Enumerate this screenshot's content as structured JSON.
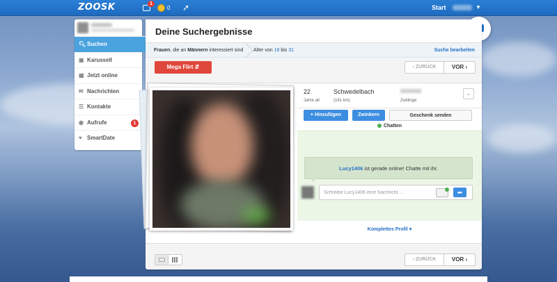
{
  "topbar": {
    "logo": "ZOOSK",
    "notifications_count": "1",
    "coins": "0",
    "start_label": "Start"
  },
  "chat_button": {
    "icon": "chat-bubble-icon"
  },
  "sidebar": {
    "items": [
      {
        "label": "Suchen",
        "icon": "search-icon",
        "active": true
      },
      {
        "label": "Karussell",
        "icon": "carousel-icon"
      },
      {
        "label": "Jetzt online",
        "icon": "online-icon"
      },
      {
        "label": "Nachrichten",
        "icon": "messages-icon"
      },
      {
        "label": "Kontakte",
        "icon": "contacts-icon"
      },
      {
        "label": "Aufrufe",
        "icon": "views-icon",
        "badge": "1"
      },
      {
        "label": "SmartDate",
        "icon": "smartdate-icon"
      }
    ]
  },
  "main": {
    "title": "Deine Suchergebnisse",
    "filter": {
      "gender": "Frauen",
      "text_mid": ", die an ",
      "seeking": "Männern",
      "text_end": " interessiert sind",
      "age_prefix": "Alter von ",
      "age_from": "18",
      "age_sep": " bis ",
      "age_to": "31",
      "edit_label": "Suche bearbeiten"
    },
    "mega_flirt": "Mega Flirt",
    "pager": {
      "back": "ZURÜCK",
      "next": "VOR"
    }
  },
  "profile": {
    "age": "22",
    "age_label": "Jahre alt",
    "city": "Schwedelbach",
    "distance": "(161 km)",
    "zodiac": "Zwillinge",
    "actions": {
      "add": "+ Hinzufügen",
      "wink": "Zwinkern",
      "gift": "Geschenk senden"
    },
    "chat_label": "Chatten",
    "online_name": "Lucy1406",
    "online_text": " ist gerade online! Chatte mit ihr.",
    "chat_placeholder": "Schreibe Lucy1406 eine Nachricht ...",
    "full_profile": "Komplettes Profil"
  },
  "colors": {
    "brand_blue": "#2670c6",
    "accent_blue": "#4aa3df",
    "red": "#e0473b",
    "chat_green": "#ecf6e6"
  }
}
